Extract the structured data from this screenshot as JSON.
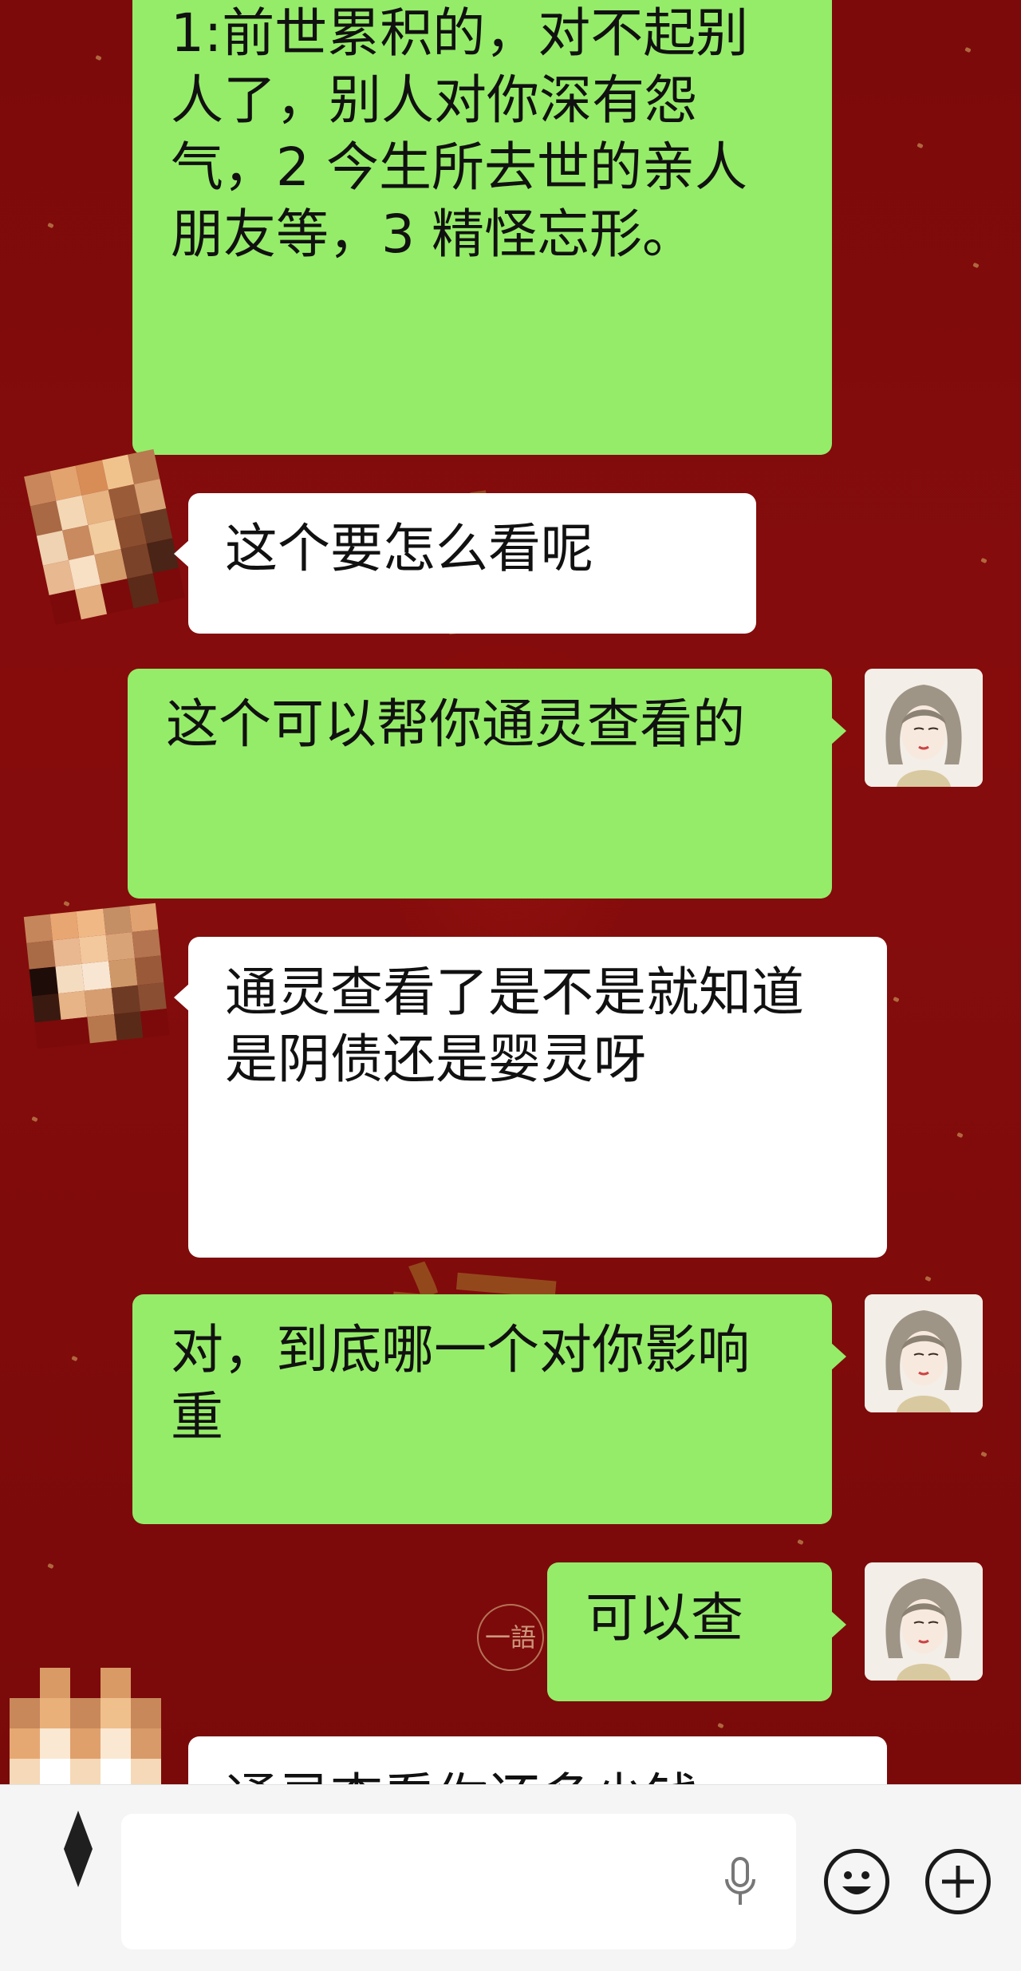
{
  "colors": {
    "background": "#7c0a0a",
    "sent_bubble": "#95ec69",
    "received_bubble": "#ffffff",
    "input_bar": "#f5f5f5"
  },
  "background_art": {
    "seal_text": "一語"
  },
  "messages": [
    {
      "direction": "sent",
      "text": "1:前世累积的，对不起别人了，别人对你深有怨气，2 今生所去世的亲人朋友等，3 精怪忘形。"
    },
    {
      "direction": "received",
      "text": "这个要怎么看呢"
    },
    {
      "direction": "sent",
      "text": "这个可以帮你通灵查看的"
    },
    {
      "direction": "received",
      "text": "通灵查看了是不是就知道是阴债还是婴灵呀"
    },
    {
      "direction": "sent",
      "text": "对，到底哪一个对你影响重"
    },
    {
      "direction": "sent",
      "text": "可以查"
    },
    {
      "direction": "received",
      "text": "通灵查看你还多少钱"
    }
  ],
  "input_bar": {
    "placeholder": "",
    "icons": {
      "voice": "microphone-icon",
      "emoji": "smiley-icon",
      "more": "plus-icon"
    }
  }
}
